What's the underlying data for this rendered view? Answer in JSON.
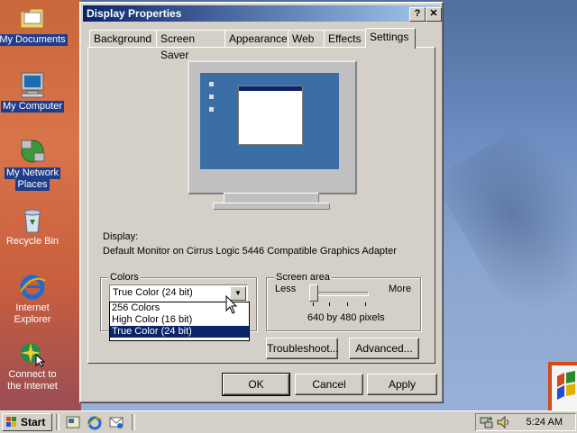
{
  "desktop": {
    "icons": [
      {
        "label": "My Documents",
        "icon": "folder-documents-icon"
      },
      {
        "label": "My Computer",
        "icon": "computer-icon"
      },
      {
        "label_line1": "My Network",
        "label_line2": "Places",
        "icon": "network-places-icon"
      },
      {
        "label": "Recycle Bin",
        "icon": "recycle-bin-icon"
      },
      {
        "label_line1": "Internet",
        "label_line2": "Explorer",
        "icon": "internet-explorer-icon"
      },
      {
        "label_line1": "Connect to",
        "label_line2": "the Internet",
        "icon": "connect-internet-icon"
      }
    ]
  },
  "window": {
    "title": "Display Properties",
    "help_glyph": "?",
    "close_glyph": "✕",
    "tabs": [
      {
        "label": "Background"
      },
      {
        "label": "Screen Saver"
      },
      {
        "label": "Appearance"
      },
      {
        "label": "Web"
      },
      {
        "label": "Effects"
      },
      {
        "label": "Settings",
        "active": true
      }
    ],
    "display_label": "Display:",
    "display_value": "Default Monitor on Cirrus Logic 5446 Compatible Graphics Adapter",
    "colors": {
      "legend": "Colors",
      "selected": "True Color (24 bit)",
      "options": [
        "256 Colors",
        "High Color (16 bit)",
        "True Color (24 bit)"
      ],
      "highlighted_index": 2
    },
    "screen_area": {
      "legend": "Screen area",
      "less": "Less",
      "more": "More",
      "value": "640 by 480 pixels",
      "slider_position": 0
    },
    "buttons": {
      "troubleshoot": "Troubleshoot...",
      "advanced": "Advanced...",
      "ok": "OK",
      "cancel": "Cancel",
      "apply": "Apply"
    }
  },
  "taskbar": {
    "start_label": "Start",
    "clock": "5:24 AM"
  },
  "colors": {
    "titlebar": "#0a246a",
    "selection": "#0a246a",
    "face": "#d4d0c8"
  }
}
